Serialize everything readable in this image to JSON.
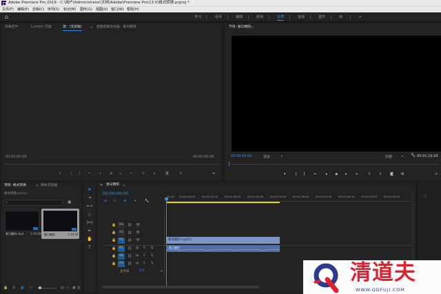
{
  "title_bar": {
    "title": "Adobe Premiere Pro 2019 - C:\\用户\\Administrator\\文档\\Adobe\\Premiere Pro\\13.0\\格式转换.prproj *"
  },
  "menu": [
    "文件(F)",
    "编辑(E)",
    "剪辑(C)",
    "序列(S)",
    "标记(M)",
    "图形(G)",
    "视图(V)",
    "窗口(W)",
    "帮助(H)"
  ],
  "workspaces": [
    "学习",
    "组件",
    "编辑",
    "颜色",
    "效果",
    "音频",
    "图形",
    "库"
  ],
  "workspace_active": "效果",
  "workspace_more": "»",
  "source_panel": {
    "tabs": [
      "效果控件",
      "Lumetri 范围",
      "源：(无剪辑)",
      "音频剪辑混合器：春日糖阳"
    ],
    "active_tab": "源：(无剪辑)",
    "timecode_left": "00;00;00;00",
    "timecode_right": "00;00;00;00"
  },
  "program_panel": {
    "title": "节目: 春日糖阳",
    "timecode": "00:00:00:00",
    "fit": "适合",
    "quality": "完整",
    "duration": "00:01:19:29"
  },
  "project_panel": {
    "tabs": [
      "项目: 格式转换",
      "媒体浏览器"
    ],
    "active_tab": "项目: 格式转换",
    "file": "格式转换.prproj",
    "items": [
      {
        "name": "春日糖阳.mp4",
        "duration": "1:19:29"
      },
      {
        "name": "春日糖阳",
        "duration": "1:19:29"
      }
    ]
  },
  "timeline": {
    "sequence": "春日糖阳",
    "timecode": "00:00:00:00",
    "ruler": [
      "00:00",
      "00:00:16:00",
      "00:00:32:00",
      "00:00:48:00",
      "00:01:04:00",
      "00:01:20:00",
      "00:01:36:00",
      "00:01:52:00",
      "00:02:08:00",
      "00:02:24:00",
      "00:02:40:00"
    ],
    "tracks": [
      {
        "name": "V3",
        "targeted": false
      },
      {
        "name": "V2",
        "targeted": false
      },
      {
        "name": "V1",
        "targeted": true
      },
      {
        "name": "A1",
        "targeted": true
      },
      {
        "name": "A2",
        "targeted": true
      },
      {
        "name": "A3",
        "targeted": true
      }
    ],
    "master": "主声道",
    "master_value": "0.0",
    "video_clip": "春日糖阳.mp4[V]",
    "audio_clip": "春日糖阳"
  },
  "colors": {
    "accent": "#2d8ceb",
    "clip": "#7b95c5",
    "audio_clip": "#4f6fa5",
    "playhead_bar": "#e8d200"
  },
  "watermark": {
    "brand": "清道夫",
    "url": "WWW.QDFUJI.COM"
  }
}
